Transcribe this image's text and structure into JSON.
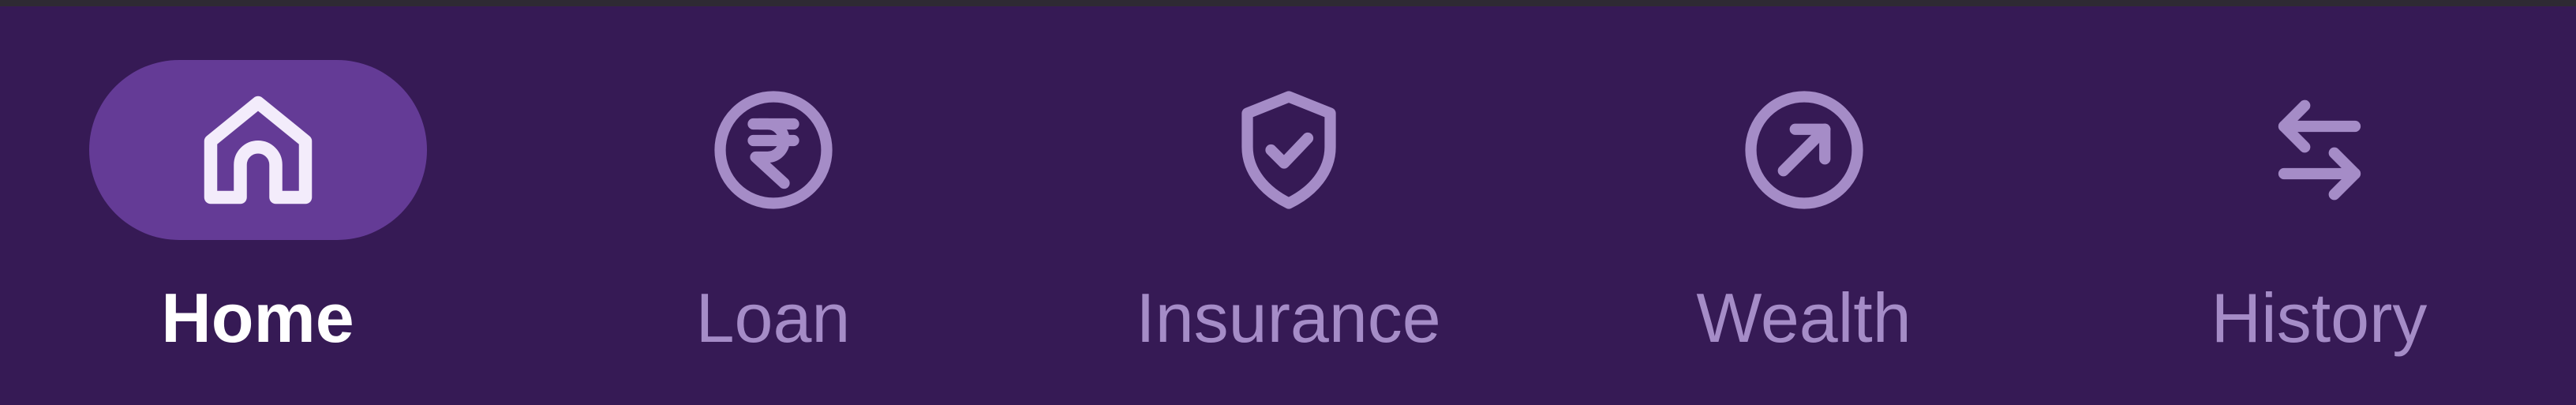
{
  "bottom_nav": {
    "active_index": 0,
    "colors": {
      "background": "#361a55",
      "active_pill": "#643b96",
      "active_text": "#ffffff",
      "inactive": "#a58cc7"
    },
    "items": [
      {
        "label": "Home",
        "icon": "home-icon"
      },
      {
        "label": "Loan",
        "icon": "rupee-circle-icon"
      },
      {
        "label": "Insurance",
        "icon": "shield-check-icon"
      },
      {
        "label": "Wealth",
        "icon": "arrow-up-right-circle-icon"
      },
      {
        "label": "History",
        "icon": "swap-arrows-icon"
      }
    ]
  }
}
